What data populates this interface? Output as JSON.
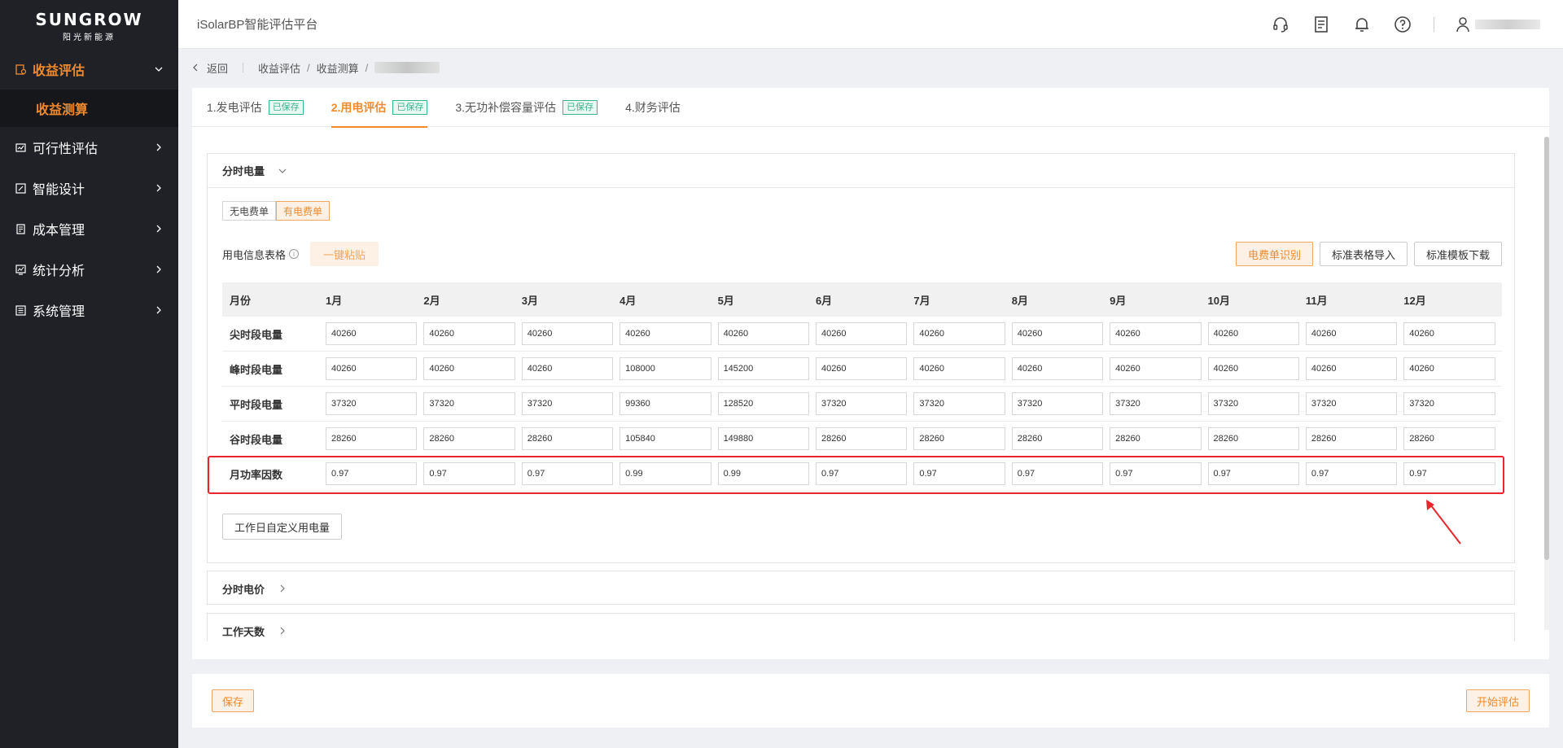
{
  "brand": {
    "logo_main": "SUNGROW",
    "logo_sub": "阳光新能源"
  },
  "sidebar": {
    "items": [
      {
        "label": "收益评估",
        "icon": "revenue-icon",
        "active": true
      },
      {
        "label": "可行性评估",
        "icon": "feasibility-icon"
      },
      {
        "label": "智能设计",
        "icon": "design-icon"
      },
      {
        "label": "成本管理",
        "icon": "cost-icon"
      },
      {
        "label": "统计分析",
        "icon": "chart-icon"
      },
      {
        "label": "系统管理",
        "icon": "system-icon"
      }
    ],
    "sub_item": "收益测算"
  },
  "topbar": {
    "app_title": "iSolarBP智能评估平台"
  },
  "breadcrumb": {
    "back": "返回",
    "level1": "收益评估",
    "level2": "收益测算"
  },
  "tabs": [
    {
      "label": "1.发电评估",
      "tag": "已保存"
    },
    {
      "label": "2.用电评估",
      "tag": "已保存",
      "active": true
    },
    {
      "label": "3.无功补偿容量评估",
      "tag": "已保存"
    },
    {
      "label": "4.财务评估"
    }
  ],
  "panel_tou": {
    "title": "分时电量",
    "seg_options": [
      "无电费单",
      "有电费单"
    ],
    "seg_selected": "有电费单",
    "table_label": "用电信息表格",
    "info": "i",
    "paste_btn": "一键粘贴",
    "buttons": [
      "电费单识别",
      "标准表格导入",
      "标准模板下载"
    ],
    "custom_btn": "工作日自定义用电量"
  },
  "table": {
    "header_label": "月份",
    "months": [
      "1月",
      "2月",
      "3月",
      "4月",
      "5月",
      "6月",
      "7月",
      "8月",
      "9月",
      "10月",
      "11月",
      "12月"
    ],
    "rows": [
      {
        "label": "尖时段电量",
        "values": [
          "40260",
          "40260",
          "40260",
          "40260",
          "40260",
          "40260",
          "40260",
          "40260",
          "40260",
          "40260",
          "40260",
          "40260"
        ]
      },
      {
        "label": "峰时段电量",
        "values": [
          "40260",
          "40260",
          "40260",
          "108000",
          "145200",
          "40260",
          "40260",
          "40260",
          "40260",
          "40260",
          "40260",
          "40260"
        ]
      },
      {
        "label": "平时段电量",
        "values": [
          "37320",
          "37320",
          "37320",
          "99360",
          "128520",
          "37320",
          "37320",
          "37320",
          "37320",
          "37320",
          "37320",
          "37320"
        ]
      },
      {
        "label": "谷时段电量",
        "values": [
          "28260",
          "28260",
          "28260",
          "105840",
          "149880",
          "28260",
          "28260",
          "28260",
          "28260",
          "28260",
          "28260",
          "28260"
        ]
      },
      {
        "label": "月功率因数",
        "values": [
          "0.97",
          "0.97",
          "0.97",
          "0.99",
          "0.99",
          "0.97",
          "0.97",
          "0.97",
          "0.97",
          "0.97",
          "0.97",
          "0.97"
        ]
      }
    ]
  },
  "panel_price": {
    "title": "分时电价"
  },
  "panel_days": {
    "title": "工作天数"
  },
  "footer": {
    "save": "保存",
    "start": "开始评估"
  },
  "colors": {
    "accent": "#f08a2c",
    "saved_green": "#3bb58f",
    "highlight_red": "#e8262b",
    "sidebar_bg": "#1f2126"
  }
}
